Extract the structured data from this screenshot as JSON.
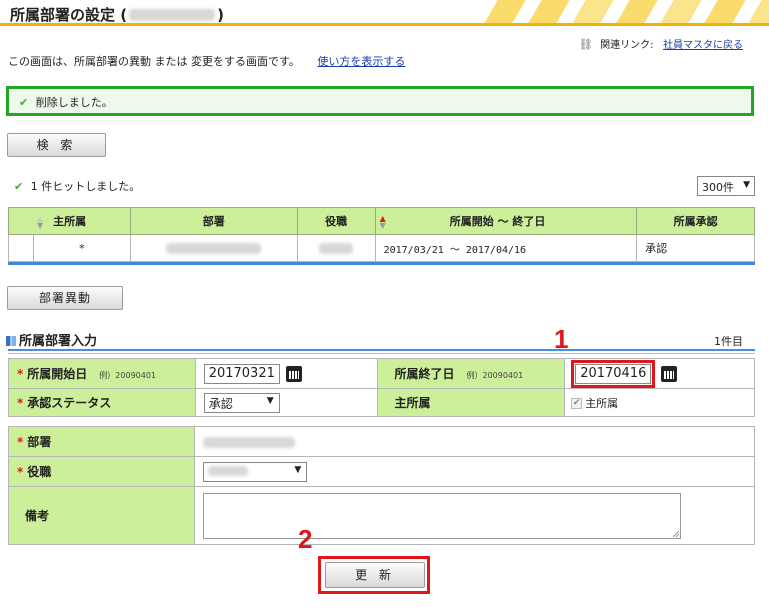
{
  "header": {
    "title_prefix": "所属部署の設定 (",
    "title_suffix": ")",
    "related_label": "関連リンク:",
    "related_link": "社員マスタに戻る"
  },
  "description": {
    "text": "この画面は、所属部署の異動 または 変更をする画面です。",
    "help_link": "使い方を表示する"
  },
  "message": "削除しました。",
  "search_button": "検 索",
  "results": {
    "hit_text": "1 件ヒットしました。",
    "per_page": "300件",
    "columns": [
      "主所属",
      "部署",
      "役職",
      "所属開始 ～ 終了日",
      "所属承認"
    ],
    "rows": [
      {
        "primary": "*",
        "period": "2017/03/21 ～ 2017/04/16",
        "approval": "承認"
      }
    ]
  },
  "transfer_button": "部署異動",
  "form": {
    "section_title": "所属部署入力",
    "count": "1件目",
    "start_date_label": "所属開始日",
    "start_date_example": "例）20090401",
    "start_date_value": "20170321",
    "end_date_label": "所属終了日",
    "end_date_example": "例）20090401",
    "end_date_value": "20170416",
    "approval_label": "承認ステータス",
    "approval_value": "承認",
    "primary_label": "主所属",
    "primary_checkbox_label": "主所属",
    "dept_label": "部署",
    "position_label": "役職",
    "notes_label": "備考"
  },
  "update_button": "更 新",
  "annotations": {
    "one": "1",
    "two": "2"
  },
  "colors": {
    "accent_gold": "#f0b400",
    "label_green": "#ccef99",
    "success_border": "#23a623",
    "annotation_red": "#e0161b",
    "link_blue": "#1a3fa8"
  }
}
